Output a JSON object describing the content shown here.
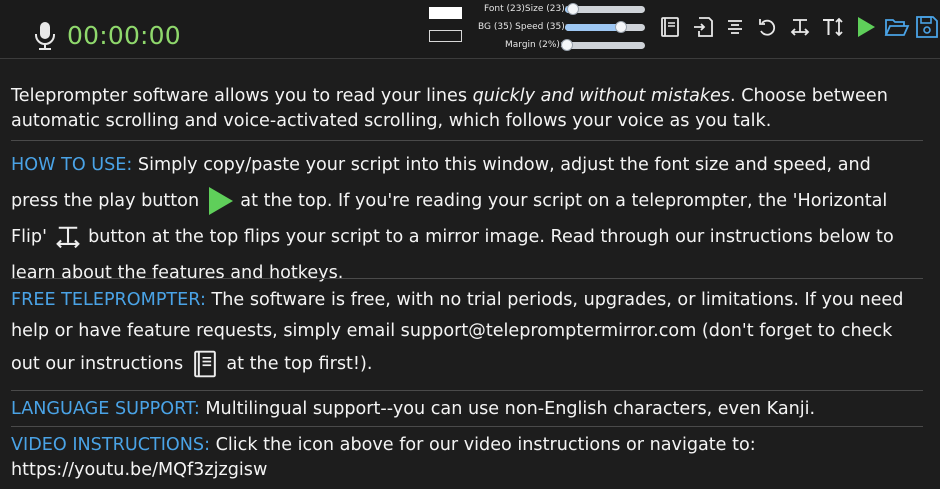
{
  "toolbar": {
    "timer": "00:00:00",
    "icons": {
      "mic": "microphone-icon",
      "instructions": "book-icon",
      "fullscreen": "enter-fullscreen-icon",
      "align": "text-align-center-icon",
      "reset": "undo-icon",
      "flip": "horizontal-flip-icon",
      "textsize": "text-height-icon",
      "play": "play-icon",
      "open": "folder-open-icon",
      "save": "save-icon"
    },
    "font_label": "Font (23)Size (23):",
    "font_size": 23,
    "bg_label": "BG (35) Speed (35):",
    "speed": 35,
    "margin_label": "Margin (2%):",
    "margin": 2,
    "colors": {
      "foreground": "#ffffff",
      "background": "#1b1b1b",
      "accent": "#4aa3e6",
      "timer": "#8fd86c",
      "play": "#5fcf5a"
    }
  },
  "script": {
    "intro": {
      "a": "Teleprompter software allows you to read your lines ",
      "b": "quickly and without mistakes",
      "c": ". Choose between automatic scrolling and voice-activated scrolling, which follows your voice as you talk."
    },
    "howto": {
      "head": "HOW TO USE:",
      "a": " Simply copy/paste your script into this window, adjust the font size and speed, and press the play button ",
      "b": " at the top.   If you're reading your script on a teleprompter, the 'Horizontal Flip' ",
      "c": " button at the top flips your script to a mirror image.   Read through our instructions below to learn about the features and hotkeys."
    },
    "free": {
      "head": "FREE TELEPROMPTER:",
      "a": " The software is free, with no trial periods, upgrades, or limitations.   If you need help or have feature requests, simply email support@teleprompter​mirror.com (don't forget to check out our instructions ",
      "b": " at the top first!)."
    },
    "language": {
      "head": "LANGUAGE SUPPORT:",
      "a": " Multilingual support--you can use non-English characters, even Kanji."
    },
    "video": {
      "head": "VIDEO INSTRUCTIONS:",
      "a": " Click the icon above for our video instructions or navigate to: https://youtu.be/MQf3zjzgisw"
    }
  }
}
